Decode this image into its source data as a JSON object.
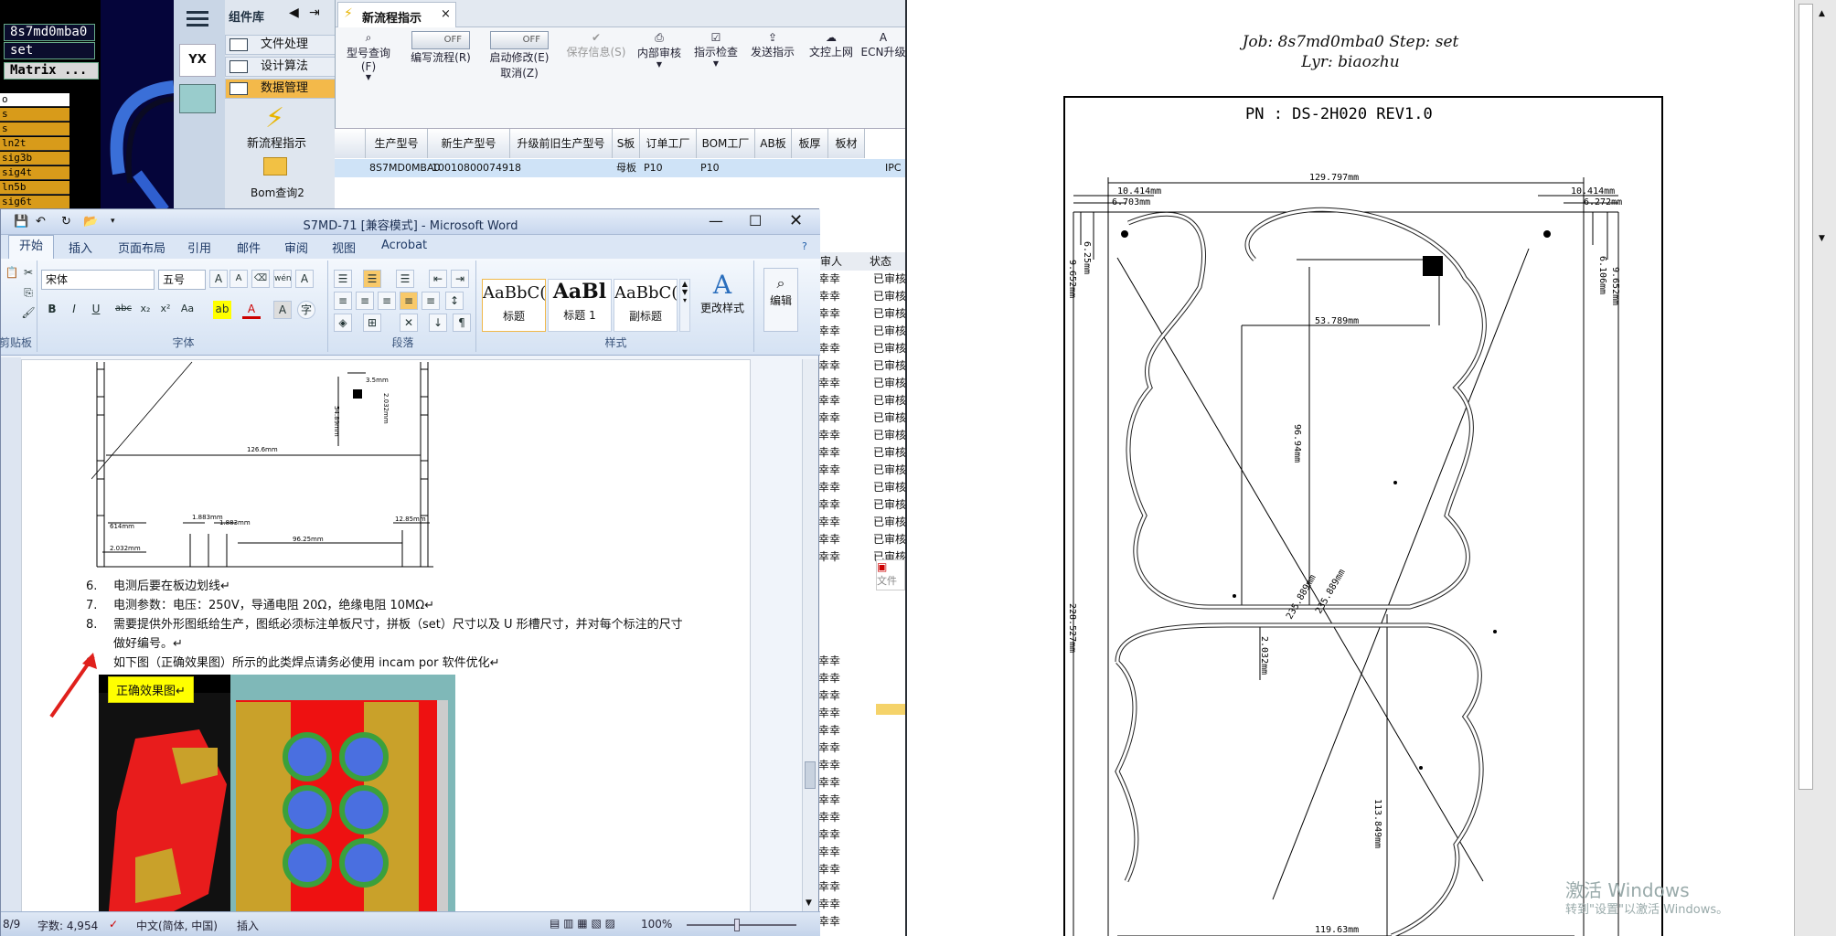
{
  "cam": {
    "job": "8s7md0mba0",
    "step": "set",
    "matrix_btn": "Matrix ...",
    "layers": [
      "o",
      "s",
      "s",
      "ln2t",
      "sig3b",
      "sig4t",
      "ln5b",
      "sig6t"
    ]
  },
  "component_panel": {
    "title": "组件库",
    "logo": "YX",
    "items": [
      "文件处理",
      "设计算法",
      "数据管理"
    ],
    "new_flow_label": "新流程指示",
    "bom_label": "Bom查询2"
  },
  "flow_window": {
    "tab_title": "新流程指示",
    "tab_close": "×",
    "tools": [
      "型号查询(F)",
      "编写流程(R)",
      "启动修改(E)",
      "保存信息(S)",
      "内部审核",
      "指示检查",
      "发送指示",
      "文控上网",
      "ECN升级"
    ],
    "toggle_off": "OFF",
    "cancel_label": "取消(Z)",
    "columns": [
      "生产型号",
      "新生产型号",
      "升级前旧生产型号",
      "S板",
      "订单工厂",
      "BOM工厂",
      "AB板",
      "板厚",
      "板材"
    ],
    "row": [
      "8S7MD0MBA0",
      "10010800074918",
      "",
      "母板",
      "P10",
      "P10",
      "",
      "",
      "",
      "IPC"
    ],
    "right_col_headers": [
      "审人",
      "状态"
    ],
    "right_col_value_a": "幸幸",
    "right_col_value_b": "已审核",
    "file_label": "文件"
  },
  "word": {
    "title": "S7MD-71 [兼容模式] - Microsoft Word",
    "tabs": [
      "开始",
      "插入",
      "页面布局",
      "引用",
      "邮件",
      "审阅",
      "视图",
      "Acrobat"
    ],
    "font_name": "宋体",
    "font_size": "五号",
    "group_font": "字体",
    "group_paragraph": "段落",
    "group_styles": "样式",
    "group_clipboard": "剪贴板",
    "styles": [
      {
        "preview": "AaBbC(",
        "name": "标题"
      },
      {
        "preview": "AaBl",
        "name": "标题 1"
      },
      {
        "preview": "AaBbC(",
        "name": "副标题"
      }
    ],
    "change_styles": "更改样式",
    "edit": "编辑",
    "lines": [
      {
        "num": "6.",
        "text": "电测后要在板边划线↵"
      },
      {
        "num": "7.",
        "text": "电测参数：电压：250V，导通电阻 20Ω，绝缘电阻 10MΩ↵"
      },
      {
        "num": "8.",
        "text": "需要提供外形图纸给生产，图纸必须标注单板尺寸，拼板（set）尺寸以及 U 形槽尺寸，并对每个标注的尺寸"
      },
      {
        "num": "",
        "text": "做好编号。↵"
      },
      {
        "num": "9.",
        "text": "如下图（正确效果图）所示的此类焊点请务必使用 incam por 软件优化↵"
      }
    ],
    "correct_label": "正确效果图↵",
    "status": {
      "page": "8/9",
      "words": "字数: 4,954",
      "lang": "中文(简体, 中国)",
      "mode": "插入",
      "zoom": "100%"
    },
    "drawing_dims": [
      "3.5mm",
      "2.032mm",
      "54.89mm",
      "126.6mm",
      "1.883mm",
      "1.883mm",
      "614mm",
      "2.032mm",
      "96.25mm",
      "12.85mm"
    ]
  },
  "pdf": {
    "job_line": "Job: 8s7md0mba0  Step: set",
    "lyr_line": "Lyr: biaozhu",
    "pn": "PN :   DS-2H020 REV1.0",
    "dims": {
      "width": "129.797mm",
      "left_a": "10.414mm",
      "left_b": "6.703mm",
      "right_a": "10.414mm",
      "right_b": "6.272mm",
      "left_v1": "6.25mm",
      "left_v2": "9.652mm",
      "right_v1": "6.106mm",
      "right_v2": "9.652mm",
      "mid_h": "53.789mm",
      "mid_v": "96.94mm",
      "diag1": "235.889mm",
      "diag2": "235.889mm",
      "total_h": "228.527mm",
      "slot": "2.032mm",
      "lower_v": "113.849mm",
      "bottom_w": "119.63mm"
    }
  },
  "watermark": {
    "line1": "激活 Windows",
    "line2": "转到\"设置\"以激活 Windows。"
  }
}
